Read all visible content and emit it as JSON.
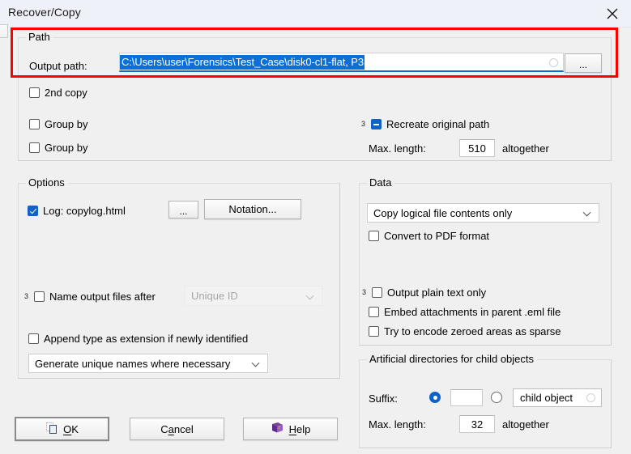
{
  "window": {
    "title": "Recover/Copy",
    "close_icon": "close-icon"
  },
  "path_group": {
    "legend": "Path",
    "output_path_label": "Output path:",
    "output_path_value": "C:\\Users\\user\\Forensics\\Test_Case\\disk0-cl1-flat, P3",
    "browse_button": "...",
    "highlight_color": "#fe0000"
  },
  "top_options": {
    "second_copy": {
      "label": "2nd copy",
      "checked": false
    },
    "group_by_1": {
      "label": "Group by",
      "checked": false
    },
    "group_by_2": {
      "label": "Group by",
      "checked": false
    },
    "recreate_original_path": {
      "label": "Recreate original path",
      "sup": "3",
      "state": "indeterminate"
    },
    "max_length_label": "Max. length:",
    "max_length_value": "510",
    "max_length_suffix": "altogether"
  },
  "options_group": {
    "legend": "Options",
    "log": {
      "label": "Log: copylog.html",
      "checked": true
    },
    "log_browse_button": "...",
    "notation_button": "Notation...",
    "name_output_files_after": {
      "label": "Name output files after",
      "sup": "3",
      "checked": false
    },
    "name_output_dropdown": {
      "value": "Unique ID",
      "disabled": true
    },
    "append_type": {
      "label": "Append type as extension if newly identified",
      "checked": false
    },
    "generate_names_dropdown": {
      "value": "Generate unique names where necessary",
      "disabled": false
    }
  },
  "data_group": {
    "legend": "Data",
    "copy_mode_dropdown": {
      "value": "Copy logical file contents only",
      "disabled": false
    },
    "convert_pdf": {
      "label": "Convert to PDF format",
      "checked": false
    },
    "output_plain_text": {
      "label": "Output plain text only",
      "sup": "3",
      "checked": false
    },
    "embed_attachments": {
      "label": "Embed attachments in parent .eml file",
      "checked": false
    },
    "encode_sparse": {
      "label": "Try to encode zeroed areas as sparse",
      "checked": false
    }
  },
  "artificial_group": {
    "legend": "Artificial directories for child objects",
    "suffix_label": "Suffix:",
    "suffix_radio_custom": {
      "selected": true
    },
    "suffix_custom_value": "",
    "suffix_radio_preset": {
      "selected": false
    },
    "suffix_preset_value": "child object",
    "max_length_label": "Max. length:",
    "max_length_value": "32",
    "max_length_suffix": "altogether"
  },
  "footer": {
    "ok_button": "OK",
    "ok_icon": "copy-icon",
    "cancel_button": "Cancel",
    "help_button": "Help",
    "help_icon": "help-book-icon"
  },
  "colors": {
    "accent": "#0f62c7",
    "selection": "#0a6fd6",
    "highlight": "#fe0000",
    "window_bg": "#f0f0f0",
    "titlebar_bg": "#eef1f7"
  }
}
